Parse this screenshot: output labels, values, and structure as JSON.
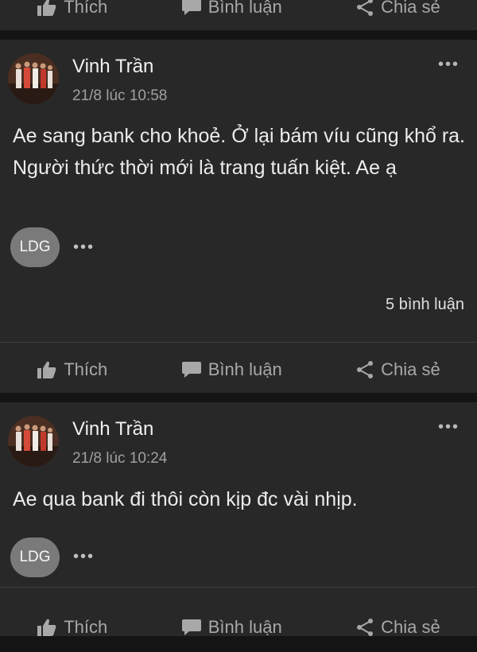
{
  "actions": {
    "like": "Thích",
    "comment": "Bình luận",
    "share": "Chia sẻ"
  },
  "posts": [
    {
      "author": "Vinh Trần",
      "time": "21/8 lúc 10:58",
      "text": "Ae sang bank cho khoẻ. Ở lại bám víu cũng khổ ra. Người thức thời mới là trang tuấn kiệt. Ae ạ",
      "chip": "LDG",
      "comments": "5 bình luận"
    },
    {
      "author": "Vinh Trần",
      "time": "21/8 lúc 10:24",
      "text": "Ae qua bank đi thôi còn kịp đc vài nhịp.",
      "chip": "LDG"
    }
  ],
  "more_glyph": "•••",
  "colors": {
    "background": "#141414",
    "card": "#282828",
    "muted": "#a8a8a8",
    "chip": "#7a7a7a"
  }
}
